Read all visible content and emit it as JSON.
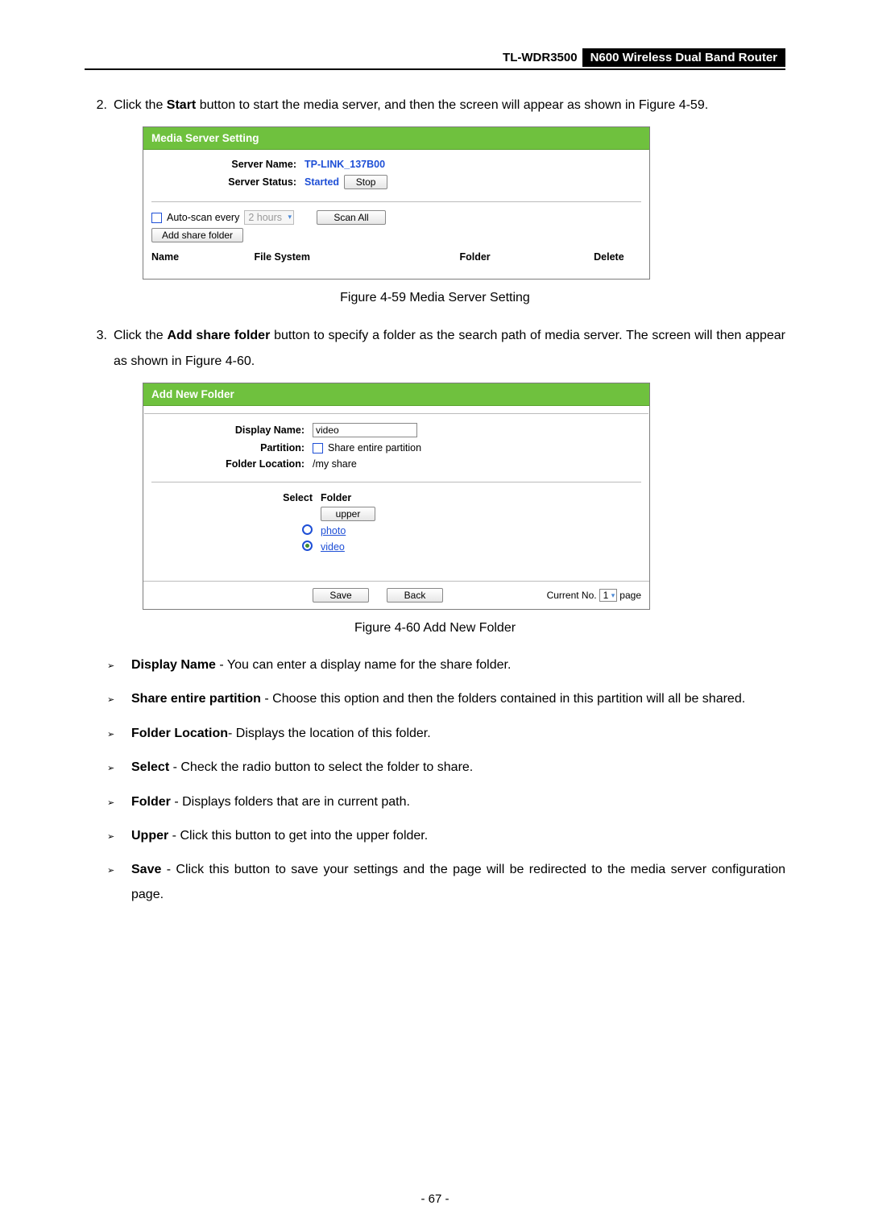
{
  "header": {
    "model": "TL-WDR3500",
    "title": "N600 Wireless Dual Band Router"
  },
  "step2": {
    "num": "2.",
    "text_a": "Click the ",
    "bold": "Start",
    "text_b": " button to start the media server, and then the screen will appear as shown in Figure 4-59."
  },
  "fig1": {
    "title": "Media Server Setting",
    "server_name_label": "Server Name:",
    "server_name_value": "TP-LINK_137B00",
    "server_status_label": "Server Status:",
    "server_status_value": "Started",
    "stop_btn": "Stop",
    "autoscan_label": "Auto-scan every",
    "autoscan_value": "2 hours",
    "scan_all_btn": "Scan All",
    "add_share_btn": "Add share folder",
    "th_name": "Name",
    "th_fs": "File System",
    "th_folder": "Folder",
    "th_delete": "Delete",
    "caption": "Figure 4-59 Media Server Setting"
  },
  "step3": {
    "num": "3.",
    "text_a": "Click the ",
    "bold": "Add share folder",
    "text_b": " button to specify a folder as the search path of media server. The screen will then appear as shown in Figure 4-60."
  },
  "fig2": {
    "title": "Add New Folder",
    "display_name_label": "Display Name:",
    "display_name_value": "video",
    "partition_label": "Partition:",
    "partition_checkbox_label": "Share entire partition",
    "folder_location_label": "Folder Location:",
    "folder_location_value": "/my share",
    "select_label": "Select",
    "folder_label": "Folder",
    "upper_btn": "upper",
    "folder_photo": "photo",
    "folder_video": "video",
    "save_btn": "Save",
    "back_btn": "Back",
    "current_no_label": "Current No.",
    "current_no_value": "1",
    "page_label": "page",
    "caption": "Figure 4-60 Add New Folder"
  },
  "bullets": {
    "b1": {
      "bold": "Display Name",
      "text": " - You can enter a display name for the share folder."
    },
    "b2": {
      "bold": "Share entire partition",
      "text": " - Choose this option and then the folders contained in this partition will all be shared."
    },
    "b3": {
      "bold": "Folder Location",
      "text": "- Displays the location of this folder."
    },
    "b4": {
      "bold": "Select",
      "text": " - Check the radio button to select the folder to share."
    },
    "b5": {
      "bold": "Folder",
      "text": " - Displays folders that are in current path."
    },
    "b6": {
      "bold": "Upper",
      "text": " - Click this button to get into the upper folder."
    },
    "b7": {
      "bold": "Save",
      "text": " - Click this button to save your settings and the page will be redirected to the media server configuration page."
    }
  },
  "page_num": "- 67 -"
}
